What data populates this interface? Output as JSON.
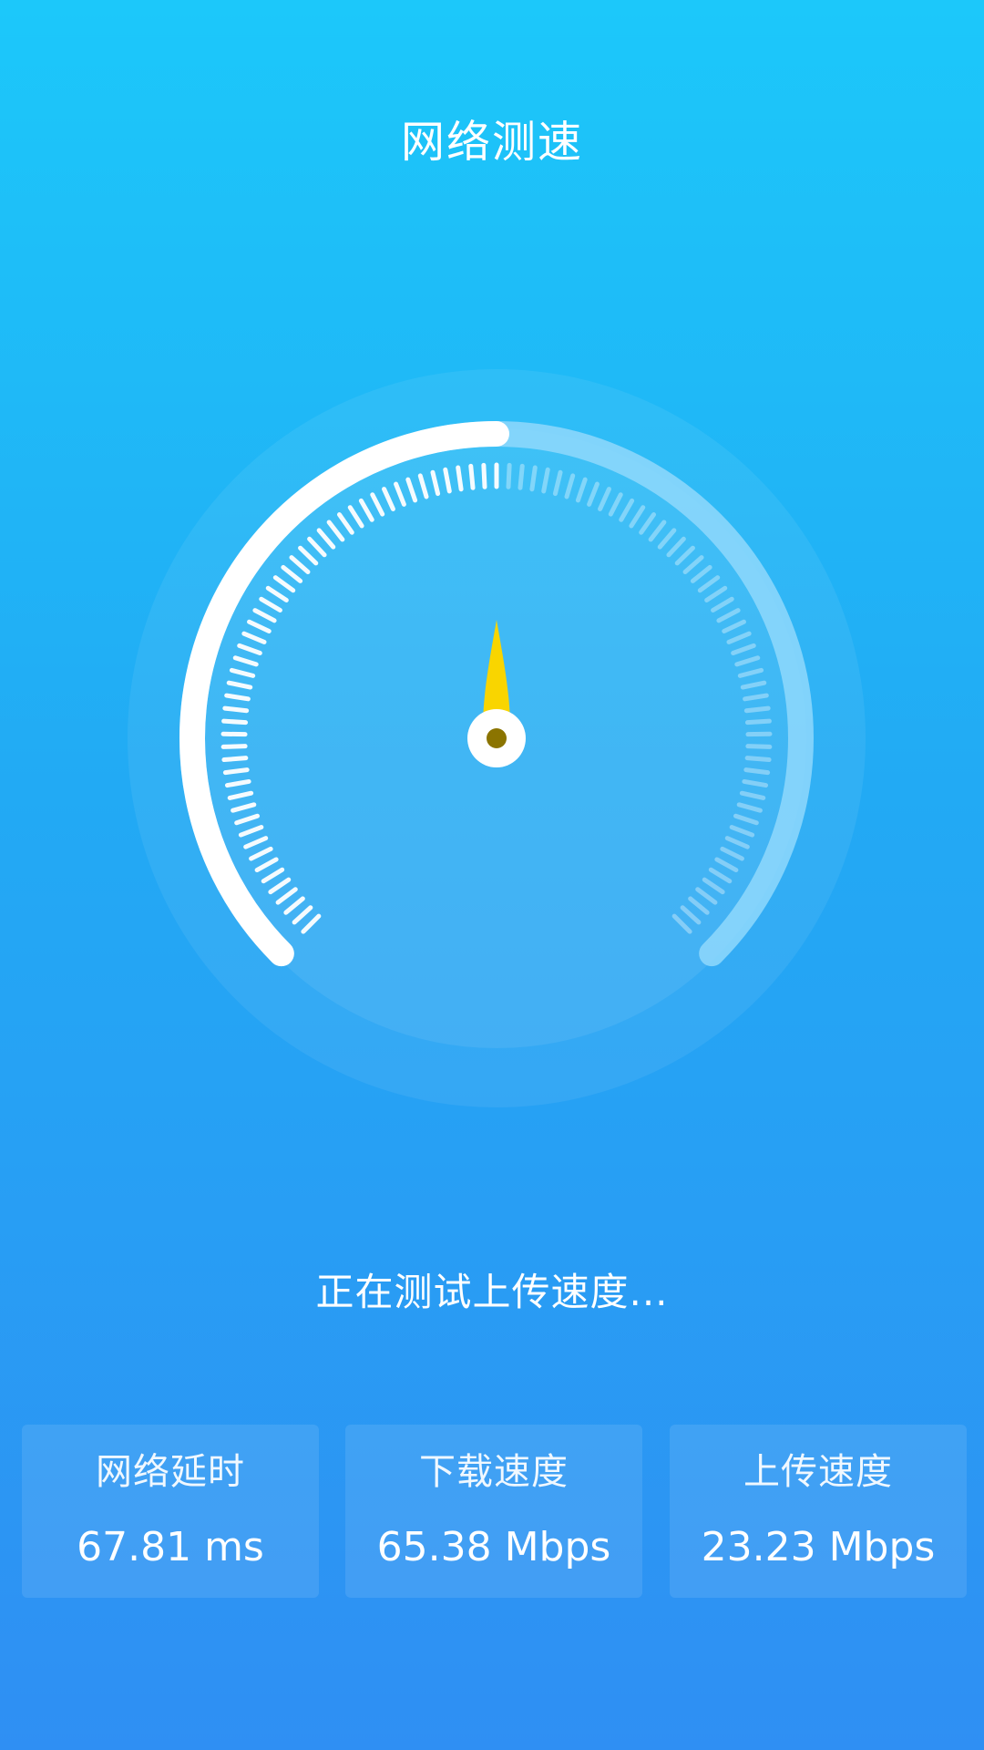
{
  "header": {
    "title": "网络测速"
  },
  "gauge": {
    "progress_fraction": 0.5,
    "needle_icon": "speedometer-needle-icon",
    "colors": {
      "needle": "#f9d500",
      "needle_hub": "#8b7400",
      "active_arc": "#ffffff",
      "track_arc": "#8fd8fb"
    }
  },
  "status": {
    "text": "正在测试上传速度..."
  },
  "stats": [
    {
      "label": "网络延时",
      "value": "67.81 ms"
    },
    {
      "label": "下载速度",
      "value": "65.38 Mbps"
    },
    {
      "label": "上传速度",
      "value": "23.23 Mbps"
    }
  ]
}
